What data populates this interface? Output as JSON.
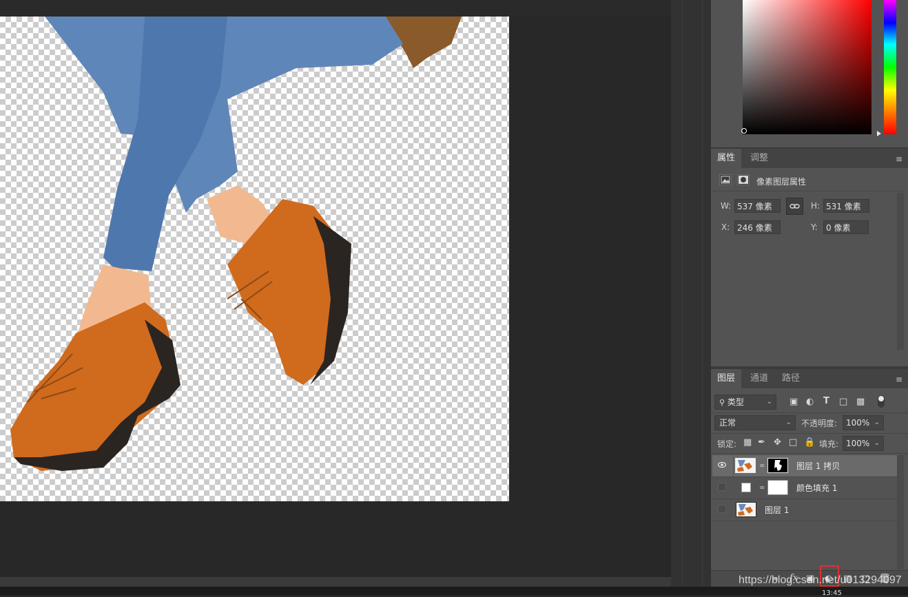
{
  "properties_panel": {
    "tabs": [
      "属性",
      "调整"
    ],
    "section_title": "像素图层属性",
    "w_label": "W:",
    "w_value": "537 像素",
    "h_label": "H:",
    "h_value": "531 像素",
    "x_label": "X:",
    "x_value": "246 像素",
    "y_label": "Y:",
    "y_value": "0 像素"
  },
  "layers_panel": {
    "tabs": [
      "图层",
      "通道",
      "路径"
    ],
    "filter_kind": "类型",
    "blend_mode": "正常",
    "opacity_label": "不透明度:",
    "opacity_value": "100%",
    "lock_label": "锁定:",
    "fill_label": "填充:",
    "fill_value": "100%",
    "layers": [
      {
        "name": "图层 1 拷贝",
        "visible": true,
        "selected": true
      },
      {
        "name": "颜色填充 1",
        "visible": false,
        "selected": false
      },
      {
        "name": "图层 1",
        "visible": false,
        "selected": false
      }
    ],
    "tooltip_time": "13:45"
  },
  "colors": {
    "highlight_box": "#e03030",
    "panel_bg": "#535353",
    "canvas_bg": "#282828"
  },
  "watermark": "https://blog.csdn.net/u013294097"
}
